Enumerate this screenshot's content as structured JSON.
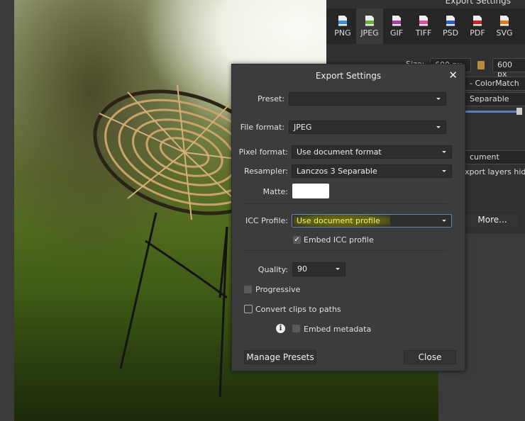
{
  "background_panel": {
    "title": "Export Settings",
    "formats": [
      {
        "label": "PNG",
        "color": "#3a8fd8"
      },
      {
        "label": "JPEG",
        "color": "#6bb03a"
      },
      {
        "label": "GIF",
        "color": "#b03ab0"
      },
      {
        "label": "TIFF",
        "color": "#e04aa0"
      },
      {
        "label": "PSD",
        "color": "#2a5fd0"
      },
      {
        "label": "PDF",
        "color": "#d02020"
      },
      {
        "label": "SVG",
        "color": "#e07a10"
      }
    ],
    "selected_format": "JPEG",
    "size_label": "Size:",
    "width_value": "600 px",
    "height_value": "600 px",
    "profile_partial": "- ColorMatch",
    "resampler_partial": "Separable",
    "area_partial": "cument",
    "hidden_layers_partial": "xport layers hidde",
    "more_button": "More..."
  },
  "dialog": {
    "title": "Export Settings",
    "close_glyph": "✕",
    "preset_label": "Preset:",
    "preset_value": "",
    "file_format_label": "File format:",
    "file_format_value": "JPEG",
    "pixel_format_label": "Pixel format:",
    "pixel_format_value": "Use document format",
    "resampler_label": "Resampler:",
    "resampler_value": "Lanczos 3 Separable",
    "matte_label": "Matte:",
    "matte_color": "#ffffff",
    "icc_label": "ICC Profile:",
    "icc_value": "Use document profile",
    "embed_icc_label": "Embed ICC profile",
    "embed_icc_checked": true,
    "quality_label": "Quality:",
    "quality_value": "90",
    "progressive_label": "Progressive",
    "progressive_checked": false,
    "convert_clips_label": "Convert clips to paths",
    "convert_clips_checked": false,
    "info_glyph": "i",
    "embed_metadata_label": "Embed metadata",
    "embed_metadata_checked": false,
    "manage_presets_button": "Manage Presets",
    "close_button": "Close"
  }
}
